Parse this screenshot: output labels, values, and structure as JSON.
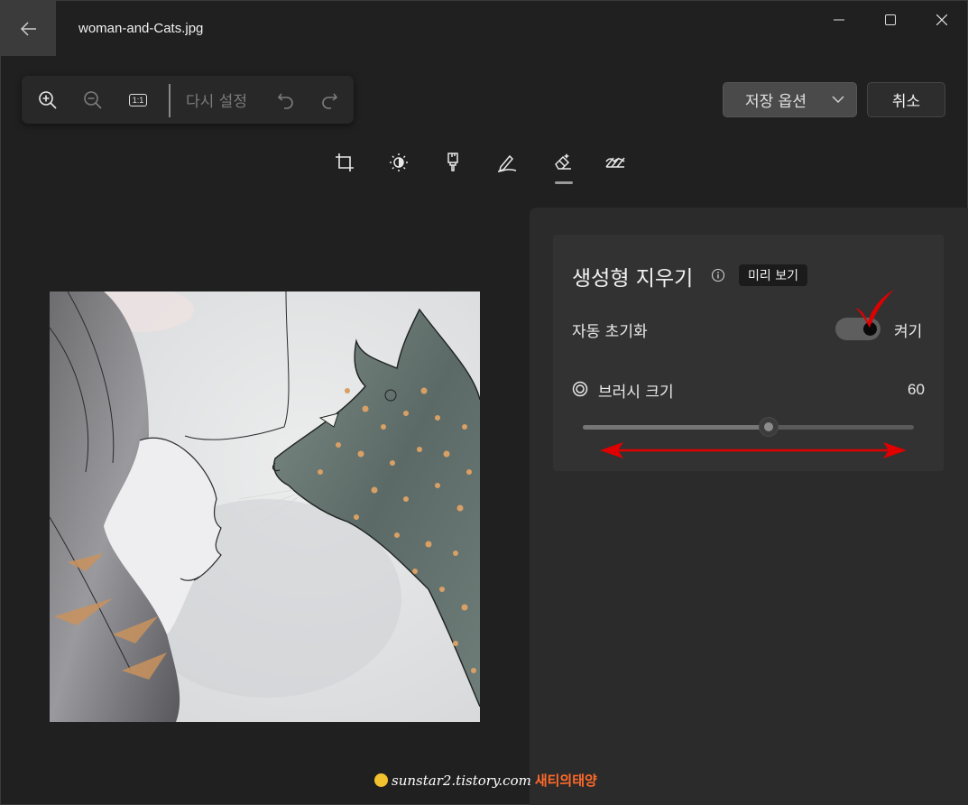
{
  "window": {
    "title": "woman-and-Cats.jpg"
  },
  "toolbar": {
    "reset_label": "다시 설정",
    "zoom_ratio_label": "1:1"
  },
  "actions": {
    "save_options_label": "저장 옵션",
    "cancel_label": "취소"
  },
  "tools": [
    "crop-icon",
    "adjust-brightness-icon",
    "filter-icon",
    "markup-pen-icon",
    "erase-icon",
    "background-icon"
  ],
  "active_tool": "erase-icon",
  "panel": {
    "title": "생성형 지우기",
    "badge": "미리 보기",
    "auto_reset_label": "자동 초기화",
    "auto_reset_state": "켜기",
    "auto_reset_on": true,
    "brush_size_label": "브러시 크기",
    "brush_size_value": "60",
    "brush_size_fraction": 0.56
  },
  "watermark": {
    "site": "sunstar2.tistory.com",
    "name": "새티의태양"
  },
  "colors": {
    "annotation_red": "#e00000",
    "cat_spots": "#d9a066"
  }
}
